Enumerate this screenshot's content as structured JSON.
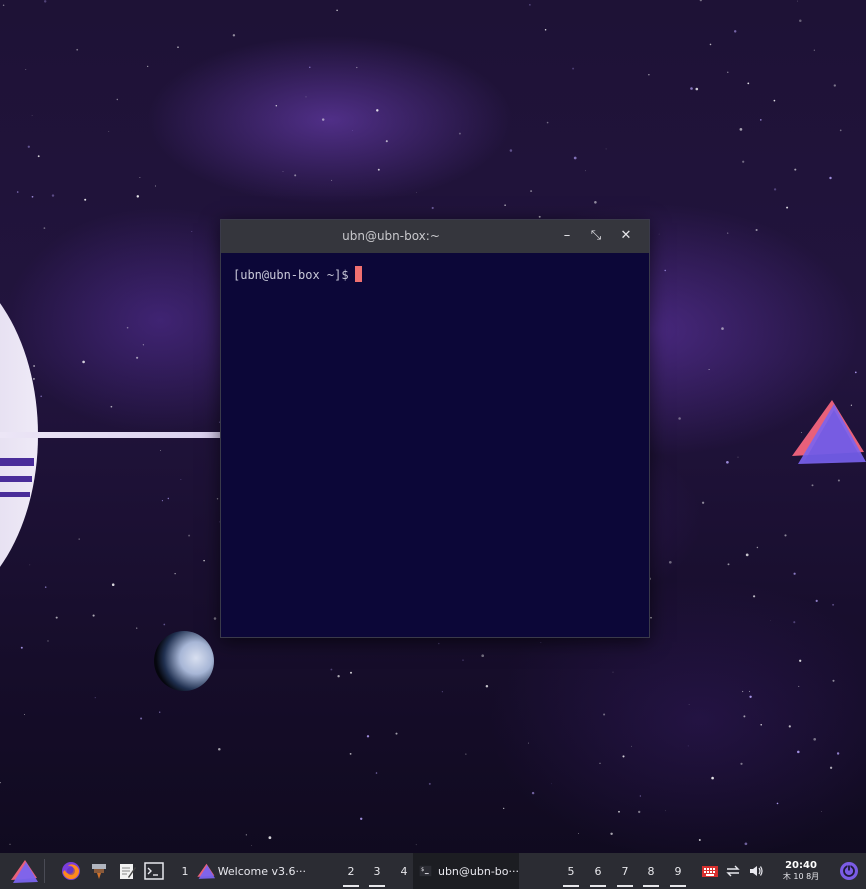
{
  "desktop": {
    "wallpaper": "space-planets",
    "accent": "#7b5ce6"
  },
  "terminal": {
    "title": "ubn@ubn-box:~",
    "prompt": "[ubn@ubn-box ~]$ ",
    "cursor_color": "#f07070",
    "buttons": {
      "minimize": "–",
      "maximize": "⤡",
      "close": "✕"
    }
  },
  "taskbar": {
    "launchers": [
      {
        "name": "app-menu",
        "icon": "garuda-logo-icon"
      },
      {
        "name": "firefox",
        "icon": "firefox-icon"
      },
      {
        "name": "files",
        "icon": "file-manager-icon"
      },
      {
        "name": "editor",
        "icon": "text-editor-icon"
      },
      {
        "name": "terminal",
        "icon": "terminal-icon"
      }
    ],
    "workspaces_left": [
      "1"
    ],
    "workspaces_mid": [
      "2",
      "3",
      "4"
    ],
    "workspaces_right": [
      "5",
      "6",
      "7",
      "8",
      "9"
    ],
    "tasks": [
      {
        "label": "Welcome v3.6···",
        "icon": "garuda-logo-icon",
        "active": false
      },
      {
        "label": "ubn@ubn-bo···",
        "icon": "terminal-icon",
        "active": true
      }
    ],
    "tray": [
      "keyboard-icon",
      "network-icon",
      "volume-icon"
    ],
    "clock": {
      "time": "20:40",
      "date": "木 10 8月"
    },
    "power_icon": "power-icon"
  }
}
